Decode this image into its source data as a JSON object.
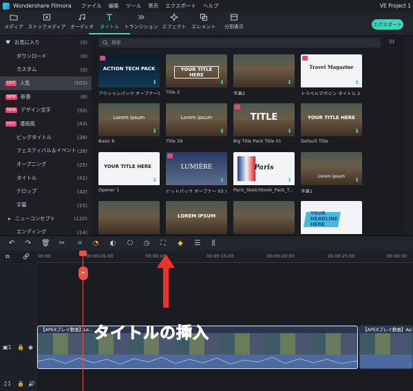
{
  "app": {
    "name": "Wondershare Filmora",
    "project": "VE Project 1"
  },
  "menu": [
    "ファイル",
    "編集",
    "ツール",
    "表示",
    "エクスポート",
    "ヘルプ"
  ],
  "toolbar": {
    "items": [
      {
        "label": "メディア",
        "icon": "folder-icon"
      },
      {
        "label": "ストックメディア",
        "icon": "image-icon"
      },
      {
        "label": "オーディオ",
        "icon": "music-icon"
      },
      {
        "label": "タイトル",
        "icon": "text-icon",
        "active": true
      },
      {
        "label": "トランジション",
        "icon": "transition-icon"
      },
      {
        "label": "エフェクト",
        "icon": "effect-icon"
      },
      {
        "label": "エレメント",
        "icon": "element-icon"
      },
      {
        "label": "分割表示",
        "icon": "split-icon"
      }
    ],
    "export_label": "エクスポート"
  },
  "sidebar": {
    "items": [
      {
        "label": "お気に入り",
        "count": "(0)"
      },
      {
        "label": "ダウンロード",
        "count": "(0)"
      },
      {
        "label": "カスタム",
        "count": "(0)"
      },
      {
        "label": "人気",
        "count": "(500)",
        "badge": "HOT"
      },
      {
        "label": "新春",
        "count": "(8)",
        "badge": "NEW"
      },
      {
        "label": "デザイン文字",
        "count": "(50)",
        "badge": "NEW"
      },
      {
        "label": "漫画風",
        "count": "(43)",
        "badge": "HOT"
      },
      {
        "label": "ビッグタイトル",
        "count": "(28)"
      },
      {
        "label": "フェスティバル＆イベント",
        "count": "(28)"
      },
      {
        "label": "オープニング",
        "count": "(25)"
      },
      {
        "label": "タイトル",
        "count": "(41)"
      },
      {
        "label": "テロップ",
        "count": "(42)"
      },
      {
        "label": "字幕",
        "count": "(15)"
      },
      {
        "label": "ニューコンセプト",
        "count": "(120)"
      },
      {
        "label": "エンディング",
        "count": "(14)"
      }
    ]
  },
  "search": {
    "placeholder": "検索"
  },
  "titles": {
    "cards": [
      {
        "caption": "アクションパック オープナー1",
        "thumb_text": "ACTION TECH PACK"
      },
      {
        "caption": "Title 2",
        "thumb_text": "YOUR TITLE HERE"
      },
      {
        "caption": "字幕2",
        "thumb_text": ""
      },
      {
        "caption": "トラベルマガジン タイトル 2",
        "thumb_text": "Travel Magazine"
      },
      {
        "caption": "Basic 6",
        "thumb_text": "Lorem ipsum"
      },
      {
        "caption": "Title 29",
        "thumb_text": "Lorem ipsum"
      },
      {
        "caption": "Big Title Pack Title 01",
        "thumb_text": "TITLE"
      },
      {
        "caption": "Default Title",
        "thumb_text": "YOUR TITLE HERE"
      },
      {
        "caption": "Opener 1",
        "thumb_text": "YOUR TITLE HERE"
      },
      {
        "caption": "ヒットパック オープナー 03 ルミ...",
        "thumb_text": "LUMIÈRE"
      },
      {
        "caption": "Paris_Sketchbook_Pack_T...",
        "thumb_text": "Paris"
      },
      {
        "caption": "字幕1",
        "thumb_text": "Lorem ipsum"
      },
      {
        "caption": "",
        "thumb_text": ""
      },
      {
        "caption": "",
        "thumb_text": "LOREM IPSUM"
      },
      {
        "caption": "",
        "thumb_text": ""
      },
      {
        "caption": "",
        "thumb_text": "YOUR HEADLINE HERE"
      }
    ]
  },
  "timeline": {
    "ticks": [
      "00:00",
      "00:00:05:00",
      "00:00:10",
      "00:00:15:00",
      "00:00:20:00",
      "00:00:25:00",
      "00:00:30"
    ],
    "clip1_label": "【APEXプレイ動画】Le...",
    "clip2_label": "【APEXプレイ動画】Ap..."
  },
  "annotation": {
    "text": "タイトルの挿入"
  }
}
